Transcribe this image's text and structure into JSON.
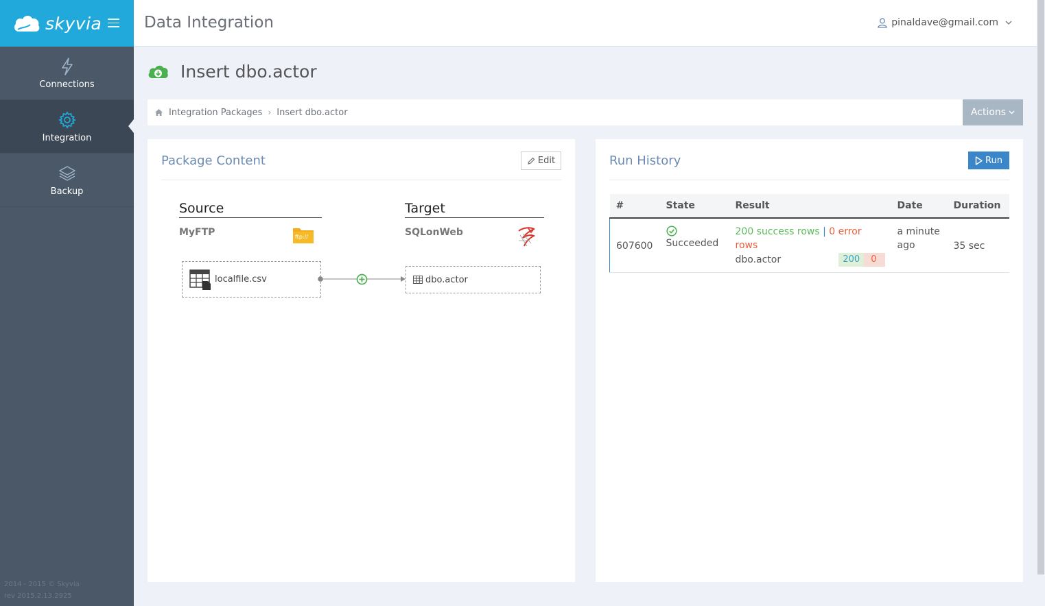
{
  "brand": {
    "name": "skyvia"
  },
  "sidebar": {
    "items": [
      {
        "label": "Connections",
        "icon": "lightning-icon"
      },
      {
        "label": "Integration",
        "icon": "gear-icon",
        "active": true
      },
      {
        "label": "Backup",
        "icon": "layers-icon"
      }
    ],
    "footer": {
      "copyright": "2014 - 2015 © Skyvia",
      "revision": "rev 2015.2.13.2925"
    }
  },
  "header": {
    "title": "Data Integration",
    "user": "pinaldave@gmail.com"
  },
  "page": {
    "title": "Insert dbo.actor",
    "icon": "cloud-download-icon"
  },
  "breadcrumb": {
    "root": "Integration Packages",
    "current": "Insert dbo.actor"
  },
  "actions": {
    "label": "Actions"
  },
  "package": {
    "title": "Package Content",
    "edit_label": "Edit",
    "source": {
      "heading": "Source",
      "connection": "MyFTP",
      "connection_icon": "ftp://",
      "object": "localfile.csv"
    },
    "target": {
      "heading": "Target",
      "connection": "SQLonWeb",
      "object": "dbo.actor"
    }
  },
  "history": {
    "title": "Run History",
    "run_label": "Run",
    "columns": [
      "#",
      "State",
      "Result",
      "Date",
      "Duration"
    ],
    "rows": [
      {
        "id": "607600",
        "state": "Succeeded",
        "success_text": "200 success rows",
        "separator": "|",
        "error_text": "0 error rows",
        "object": "dbo.actor",
        "success_count": "200",
        "error_count": "0",
        "date_line1": "a minute",
        "date_line2": "ago",
        "duration": "35 sec"
      }
    ]
  },
  "colors": {
    "brand": "#21a9db",
    "sidebar": "#4a5867",
    "primary": "#3a86c8",
    "success": "#5cb85c",
    "error": "#e8603c"
  }
}
